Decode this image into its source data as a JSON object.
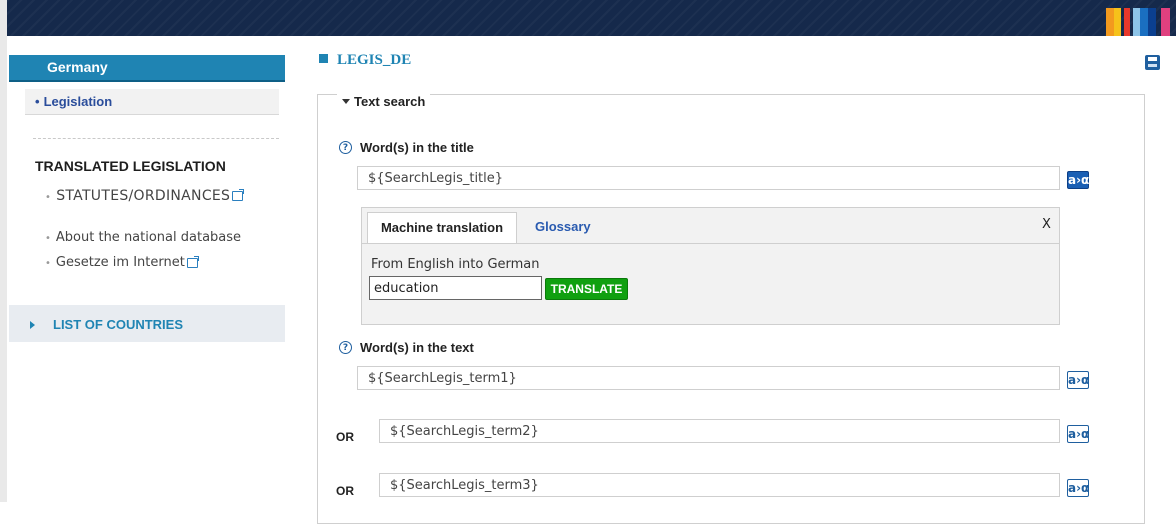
{
  "sidebar": {
    "country": "Germany",
    "legislation_label": "Legislation",
    "translated_title": "TRANSLATED LEGISLATION",
    "statutes_link": "STATUTES/ORDINANCES",
    "about_link": "About the national database",
    "gesetze_link": "Gesetze im Internet",
    "countries_label": "LIST OF COUNTRIES"
  },
  "page": {
    "title": "LEGIS_DE"
  },
  "text_search": {
    "legend": "Text search",
    "title_label": "Word(s) in the title",
    "title_value": "${SearchLegis_title}",
    "text_label": "Word(s) in the text",
    "term1_value": "${SearchLegis_term1}",
    "term2_value": "${SearchLegis_term2}",
    "term3_value": "${SearchLegis_term3}",
    "or_label": "OR",
    "ax_label": "a›α",
    "help_glyph": "?"
  },
  "translation": {
    "tab_machine": "Machine translation",
    "tab_glossary": "Glossary",
    "close": "X",
    "from_label": "From English into German",
    "input_value": "education",
    "button_label": "TRANSLATE"
  },
  "colors": {
    "banner": "#15294b",
    "accent": "#1f84b3",
    "translate_button": "#10a010"
  }
}
